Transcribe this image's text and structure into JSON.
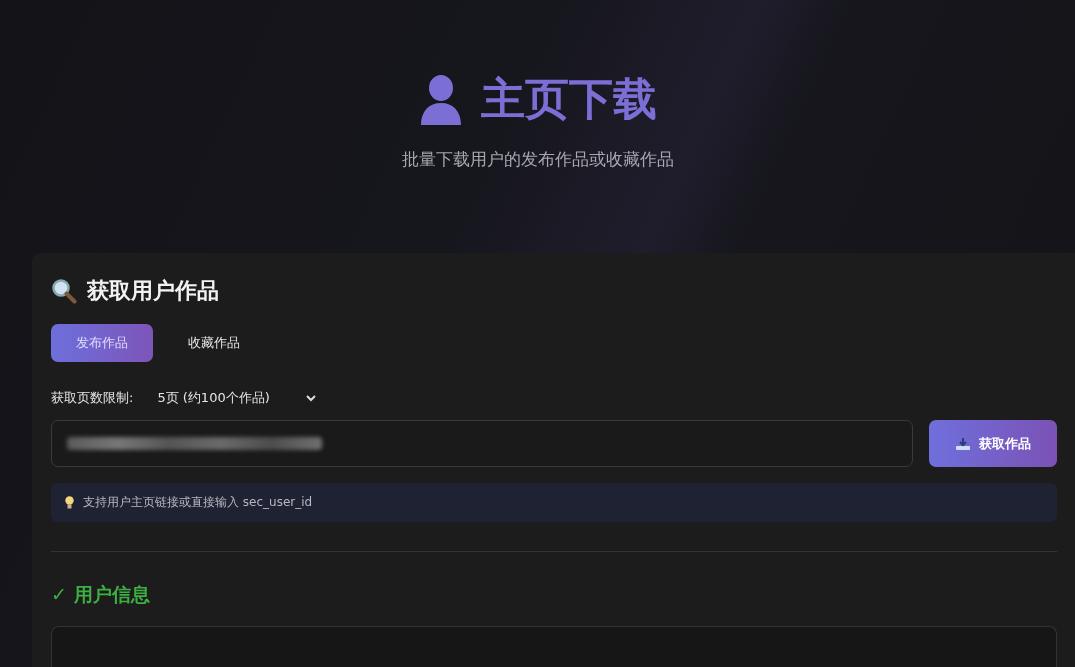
{
  "header": {
    "title": "主页下载",
    "subtitle": "批量下载用户的发布作品或收藏作品"
  },
  "panel": {
    "title": "获取用户作品",
    "tabs": [
      {
        "label": "发布作品",
        "selected": true
      },
      {
        "label": "收藏作品",
        "selected": false
      }
    ],
    "page_limit": {
      "label": "获取页数限制:",
      "value": "5页 (约100个作品)"
    },
    "url_input": {
      "redacted": true
    },
    "fetch_button": "获取作品",
    "hint": "支持用户主页链接或直接输入 sec_user_id",
    "user_info": {
      "title": "✓ 用户信息"
    }
  }
}
